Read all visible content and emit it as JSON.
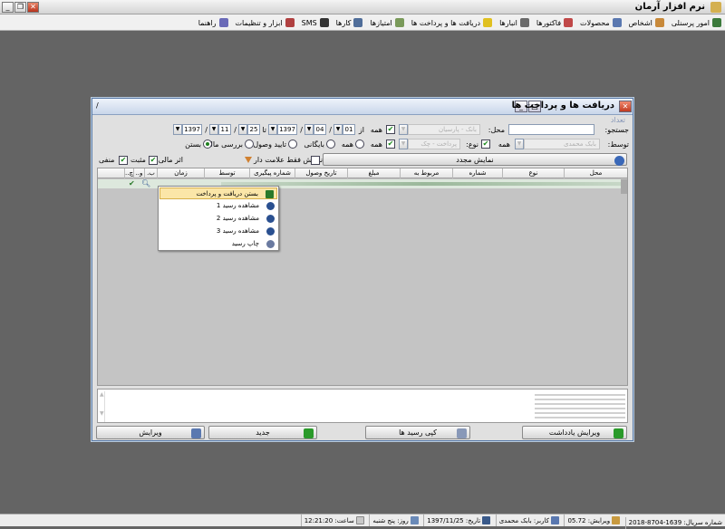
{
  "app": {
    "title": "نرم افزار آرمان"
  },
  "menu": [
    {
      "label": "امور پرسنلی",
      "icon": "people-icon",
      "color": "#3c7a3c"
    },
    {
      "label": "اشخاص",
      "icon": "person-icon",
      "color": "#c8893a"
    },
    {
      "label": "محصولات",
      "icon": "box-icon",
      "color": "#5a78b0"
    },
    {
      "label": "فاکتورها",
      "icon": "invoice-icon",
      "color": "#c04848"
    },
    {
      "label": "انبارها",
      "icon": "warehouse-icon",
      "color": "#6a6a6a"
    },
    {
      "label": "دریافت ها و پرداخت ها",
      "icon": "money-icon",
      "color": "#e0c020"
    },
    {
      "label": "امتیازها",
      "icon": "star-icon",
      "color": "#7a9a5a"
    },
    {
      "label": "کارها",
      "icon": "tasks-icon",
      "color": "#506e9a"
    },
    {
      "label": "SMS",
      "icon": "sms-icon",
      "color": "#333333"
    },
    {
      "label": "ابزار و تنظیمات",
      "icon": "tools-icon",
      "color": "#b04040"
    },
    {
      "label": "راهنما",
      "icon": "help-icon",
      "color": "#6a6ab8"
    }
  ],
  "dialog": {
    "title": "دریافت ها و پرداخت ها",
    "count_label": "تعداد",
    "search_label": "جستجو:",
    "place_label": "محل:",
    "place_value": "بانک - پارسیان",
    "by_label": "توسط:",
    "by_value": "بابک محمدی",
    "type_label": "نوع:",
    "type_value": "پرداخت - چک",
    "all_label": "همه",
    "from_label": "از",
    "to_label": "تا",
    "date_from": {
      "day": "01",
      "month": "04",
      "year": "1397"
    },
    "date_to": {
      "day": "25",
      "month": "11",
      "year": "1397"
    },
    "radio_all": "همه",
    "radio_archive": "بایگانی",
    "radio_confirm": "تایید وصول",
    "radio_review": "بررسی مالی",
    "radio_closed": "بستن",
    "refresh_label": "نمایش مجدد",
    "flag_only_label": "نمایش فقط علامت دار",
    "effect_label": "اثر مالی:",
    "positive_label": "مثبت",
    "negative_label": "منفی",
    "columns": [
      "محل",
      "نوع",
      "شماره",
      "مربوط به",
      "مبلغ",
      "تاریخ وصول",
      "شماره پیگیری",
      "توسط",
      "زمان",
      "ب.",
      "و..",
      "چ.."
    ],
    "context_menu": [
      "بستن دریافت و پرداخت",
      "مشاهده رسید 1",
      "مشاهده رسید 2",
      "مشاهده رسید 3",
      "چاپ رسید"
    ],
    "buttons": {
      "edit_note": "ویرایش یادداشت",
      "copy_receipts": "کپی رسید ها",
      "new": "جدید",
      "edit": "ویرایش"
    },
    "colors": {
      "green": "#2a9a2a",
      "title_blue": "#c9d6ea",
      "highlight": "#fbe6a8"
    }
  },
  "status": {
    "serial": "شماره سریال: 1639-8704-2018",
    "version": "ویرایش: 05.72",
    "user": "کاربر: بابک محمدی",
    "date": "تاریخ: 1397/11/25",
    "day": "روز: پنج شنبه",
    "time": "ساعت: 12:21:20"
  }
}
